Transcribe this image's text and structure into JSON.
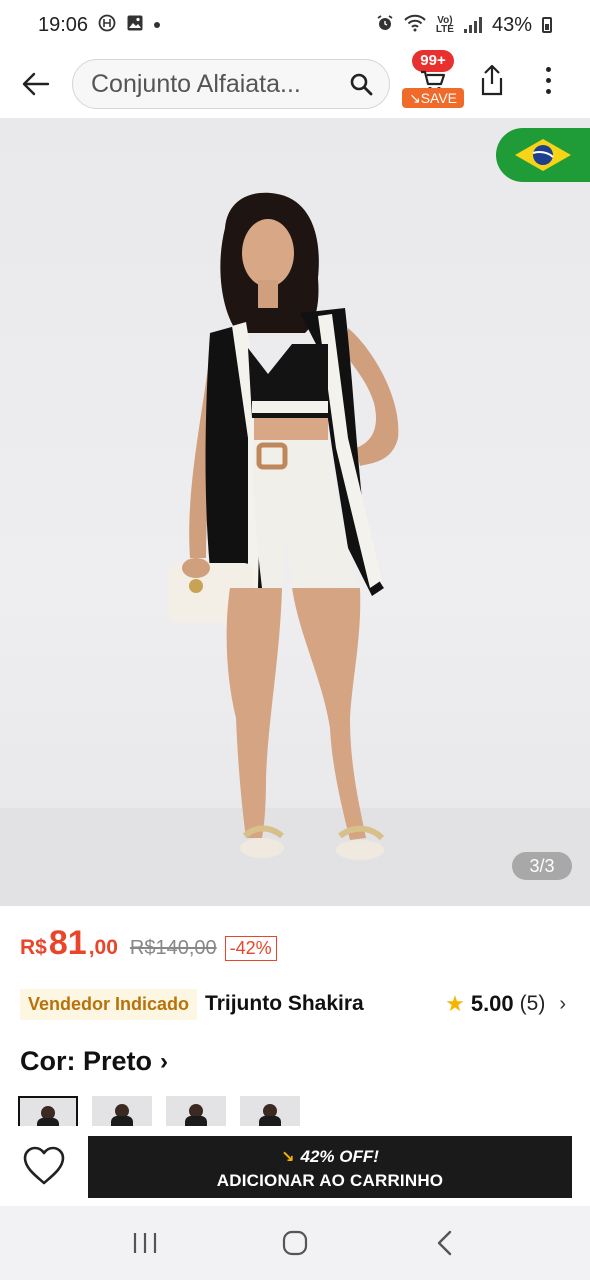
{
  "status_bar": {
    "time": "19:06",
    "battery": "43%",
    "network": "LTE"
  },
  "app_bar": {
    "search_text": "Conjunto Alfaiata...",
    "cart_badge": "99+",
    "save_label": "SAVE"
  },
  "hero": {
    "counter": "3/3"
  },
  "price": {
    "currency": "R$",
    "integer": "81",
    "decimal": ",00",
    "original": "R$140,00",
    "discount": "-42%"
  },
  "seller": {
    "badge": "Vendedor Indicado",
    "name": "Trijunto Shakira",
    "rating": "5.00",
    "review_count": "(5)"
  },
  "color": {
    "label": "Cor: Preto"
  },
  "bottom_bar": {
    "off_label": "42% OFF!",
    "add_to_cart": "ADICIONAR AO CARRINHO"
  },
  "colors": {
    "accent": "#e9452b",
    "seller_badge": "#b8720a",
    "cart_button": "#1a1a1a",
    "star": "#f5b400",
    "flag_green": "#1f9b38"
  }
}
